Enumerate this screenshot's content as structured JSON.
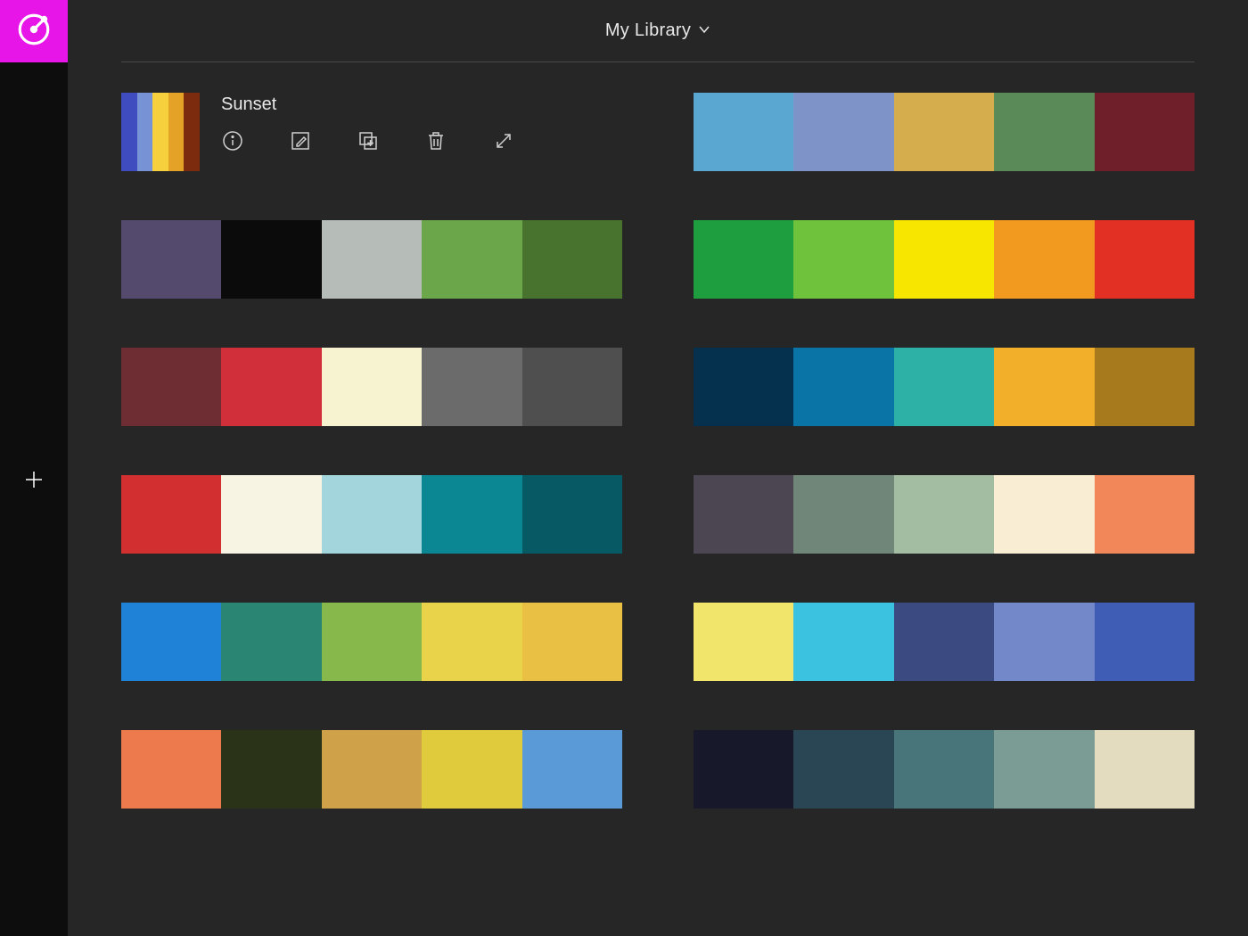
{
  "header": {
    "library_label": "My Library"
  },
  "selected": {
    "name": "Sunset",
    "colors": [
      "#3f4cc0",
      "#7793d6",
      "#f7d13d",
      "#e4a326",
      "#7c2b0f"
    ]
  },
  "palettes_right_top": [
    "#5aa8d1",
    "#7e93c8",
    "#d6ad4d",
    "#5a8a58",
    "#6e1f2a"
  ],
  "palettes": [
    [
      "#534a6d",
      "#0b0b0b",
      "#b6bdb8",
      "#6ba64a",
      "#47732f"
    ],
    [
      "#1f9e3f",
      "#6fc23c",
      "#f6e600",
      "#f29a1f",
      "#e33025"
    ],
    [
      "#6e2c33",
      "#d12f3a",
      "#f7f2d0",
      "#6b6b6b",
      "#4f4f4f"
    ],
    [
      "#05314f",
      "#0a74a6",
      "#2db1a6",
      "#f2b02a",
      "#a87a1e"
    ],
    [
      "#d12f30",
      "#f8f4e3",
      "#a3d5dd",
      "#0b8693",
      "#075a63"
    ],
    [
      "#4c4552",
      "#6f8678",
      "#a3bda3",
      "#f9edd3",
      "#f2885a"
    ],
    [
      "#1f82d6",
      "#2a8573",
      "#86b84c",
      "#e8d34a",
      "#e9c043"
    ],
    [
      "#f2e56c",
      "#3bc2e0",
      "#3b4a80",
      "#7288c9",
      "#3f5db5"
    ],
    [
      "#ed7a4d",
      "#2a3318",
      "#cfa24a",
      "#e0cb3c",
      "#5a9ad6"
    ],
    [
      "#17192b",
      "#2a4554",
      "#48757a",
      "#7a9c95",
      "#e3dcbf"
    ]
  ],
  "icons": {
    "info": "info-icon",
    "edit": "edit-icon",
    "duplicate": "duplicate-icon",
    "delete": "trash-icon",
    "expand": "expand-icon",
    "add": "plus-icon",
    "logo": "color-wheel-icon",
    "chevron": "chevron-down-icon"
  }
}
